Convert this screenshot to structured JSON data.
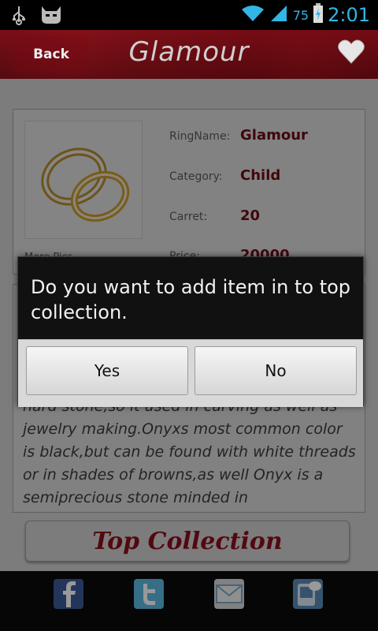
{
  "status_bar": {
    "battery_percent": "75",
    "time": "2:01",
    "icons": [
      "usb-icon",
      "cyanogen-icon",
      "wifi-icon",
      "signal-icon",
      "battery-icon"
    ]
  },
  "header": {
    "back_label": "Back",
    "title": "Glamour",
    "favorite_icon": "heart-icon"
  },
  "details": {
    "ring_name_label": "RingName:",
    "ring_name_value": "Glamour",
    "category_label": "Category:",
    "category_value": "Child",
    "carret_label": "Carret:",
    "carret_value": "20",
    "price_label": "Price:",
    "price_value": "20000",
    "more_pics_label": "More Pics"
  },
  "description": {
    "text": "hard stone,so it used in carving as well as jewelry making.Onyxs most common color is black,but can be found with white threads or in shades of browns,as well Onyx is a semiprecious stone minded in Brazil,California,India and Uruguay. Onyx is"
  },
  "top_collection_button": "Top Collection",
  "share_bar": {
    "icons": [
      "facebook-icon",
      "twitter-icon",
      "email-icon",
      "sms-icon"
    ]
  },
  "dialog": {
    "message": "Do you want to add item in to top collection.",
    "yes_label": "Yes",
    "no_label": "No"
  },
  "colors": {
    "header_red": "#5a0810",
    "value_red": "#6b0a14",
    "status_blue": "#33b5e5"
  }
}
